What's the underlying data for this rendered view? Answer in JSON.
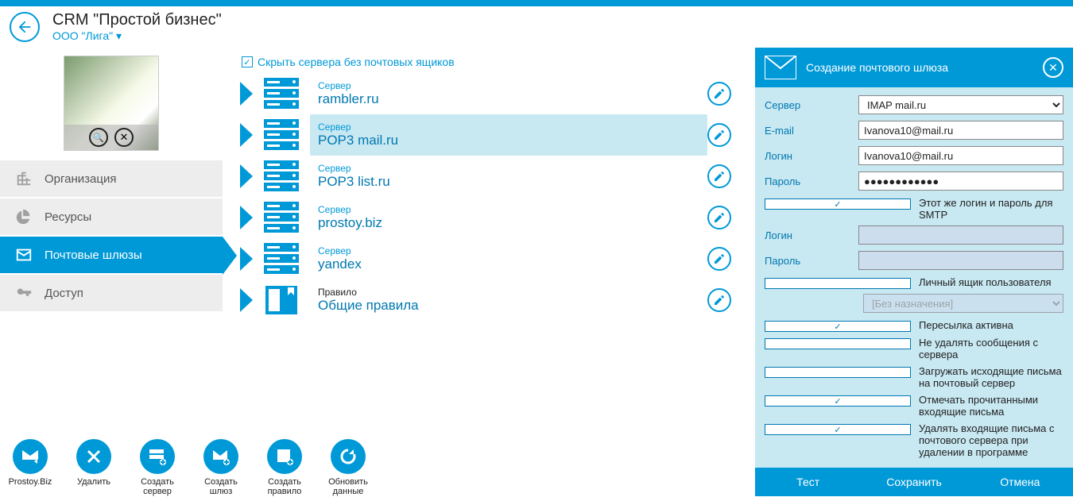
{
  "header": {
    "app_title": "CRM \"Простой бизнес\"",
    "org_name": "ООО \"Лига\" ▾"
  },
  "nav": {
    "items": [
      {
        "label": "Организация"
      },
      {
        "label": "Ресурсы"
      },
      {
        "label": "Почтовые шлюзы"
      },
      {
        "label": "Доступ"
      }
    ]
  },
  "hide_servers_label": "Скрыть сервера без почтовых ящиков",
  "servers": [
    {
      "type_label": "Сервер",
      "name": "rambler.ru"
    },
    {
      "type_label": "Сервер",
      "name": "POP3 mail.ru",
      "selected": true
    },
    {
      "type_label": "Сервер",
      "name": "POP3 list.ru"
    },
    {
      "type_label": "Сервер",
      "name": "prostoy.biz"
    },
    {
      "type_label": "Сервер",
      "name": "yandex"
    },
    {
      "type_label": "Правило",
      "name": "Общие правила",
      "rule": true
    }
  ],
  "toolbar": {
    "items": [
      {
        "label": "Prostoy.Biz"
      },
      {
        "label": "Удалить"
      },
      {
        "label": "Создать\nсервер"
      },
      {
        "label": "Создать шлюз"
      },
      {
        "label": "Создать\nправило"
      },
      {
        "label": "Обновить\nданные"
      }
    ]
  },
  "panel": {
    "title": "Создание почтового шлюза",
    "fields": {
      "server_label": "Сервер",
      "server_value": "IMAP mail.ru",
      "email_label": "E-mail",
      "email_value": "Ivanova10@mail.ru",
      "login_label": "Логин",
      "login_value": "Ivanova10@mail.ru",
      "password_label": "Пароль",
      "password_value": "●●●●●●●●●●●●",
      "smtp_same_label": "Этот же логин и пароль для SMTP",
      "login2_label": "Логин",
      "password2_label": "Пароль",
      "personal_box_label": "Личный ящик пользователя",
      "assignment_placeholder": "[Без назначения]",
      "forward_active_label": "Пересылка активна",
      "no_delete_label": "Не удалять сообщения с сервера",
      "upload_outgoing_label": "Загружать исходящие письма на почтовый сервер",
      "mark_read_label": "Отмечать прочитанными входящие письма",
      "delete_incoming_label": "Удалять входящие письма с почтового сервера при удалении в программе"
    },
    "footer": {
      "test": "Тест",
      "save": "Сохранить",
      "cancel": "Отмена"
    }
  }
}
